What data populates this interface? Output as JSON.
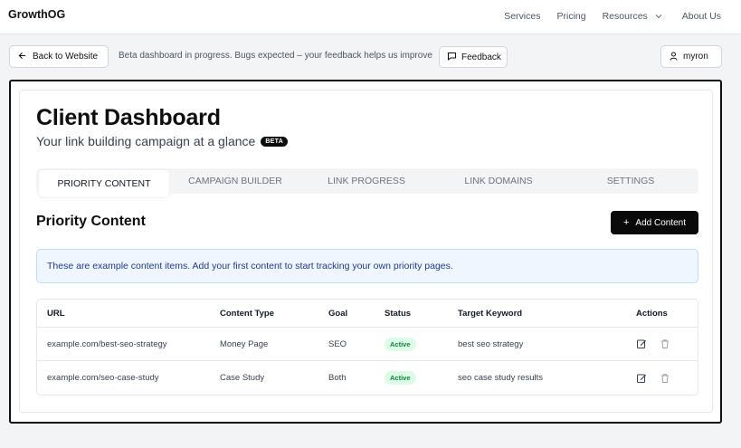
{
  "nav": {
    "logo": "GrowthOG",
    "links": [
      "Services",
      "Pricing",
      "Resources",
      "About Us"
    ]
  },
  "beta_bar": {
    "back_label": "Back to Website",
    "note": "Beta dashboard in progress. Bugs expected – your feedback helps us improve",
    "feedback_label": "Feedback",
    "user_label": "myron"
  },
  "header": {
    "title": "Client Dashboard",
    "subtitle": "Your link building campaign at a glance",
    "badge": "BETA"
  },
  "tabs": [
    {
      "label": "PRIORITY CONTENT",
      "active": true
    },
    {
      "label": "CAMPAIGN BUILDER",
      "active": false
    },
    {
      "label": "LINK PROGRESS",
      "active": false
    },
    {
      "label": "LINK DOMAINS",
      "active": false
    },
    {
      "label": "SETTINGS",
      "active": false
    }
  ],
  "section": {
    "title": "Priority Content",
    "add_label": "Add Content",
    "info": "These are example content items. Add your first content to start tracking your own priority pages."
  },
  "table": {
    "columns": [
      "URL",
      "Content Type",
      "Goal",
      "Status",
      "Target Keyword",
      "Actions"
    ],
    "rows": [
      {
        "url": "example.com/best-seo-strategy",
        "type": "Money Page",
        "goal": "SEO",
        "status": "Active",
        "keyword": "best seo strategy"
      },
      {
        "url": "example.com/seo-case-study",
        "type": "Case Study",
        "goal": "Both",
        "status": "Active",
        "keyword": "seo case study results"
      }
    ]
  },
  "colors": {
    "primary": "#0a0a0a",
    "info_bg": "#eff6ff",
    "info_text": "#1e3a8a",
    "status_active_bg": "#dcfce7",
    "status_active_text": "#15803d"
  }
}
